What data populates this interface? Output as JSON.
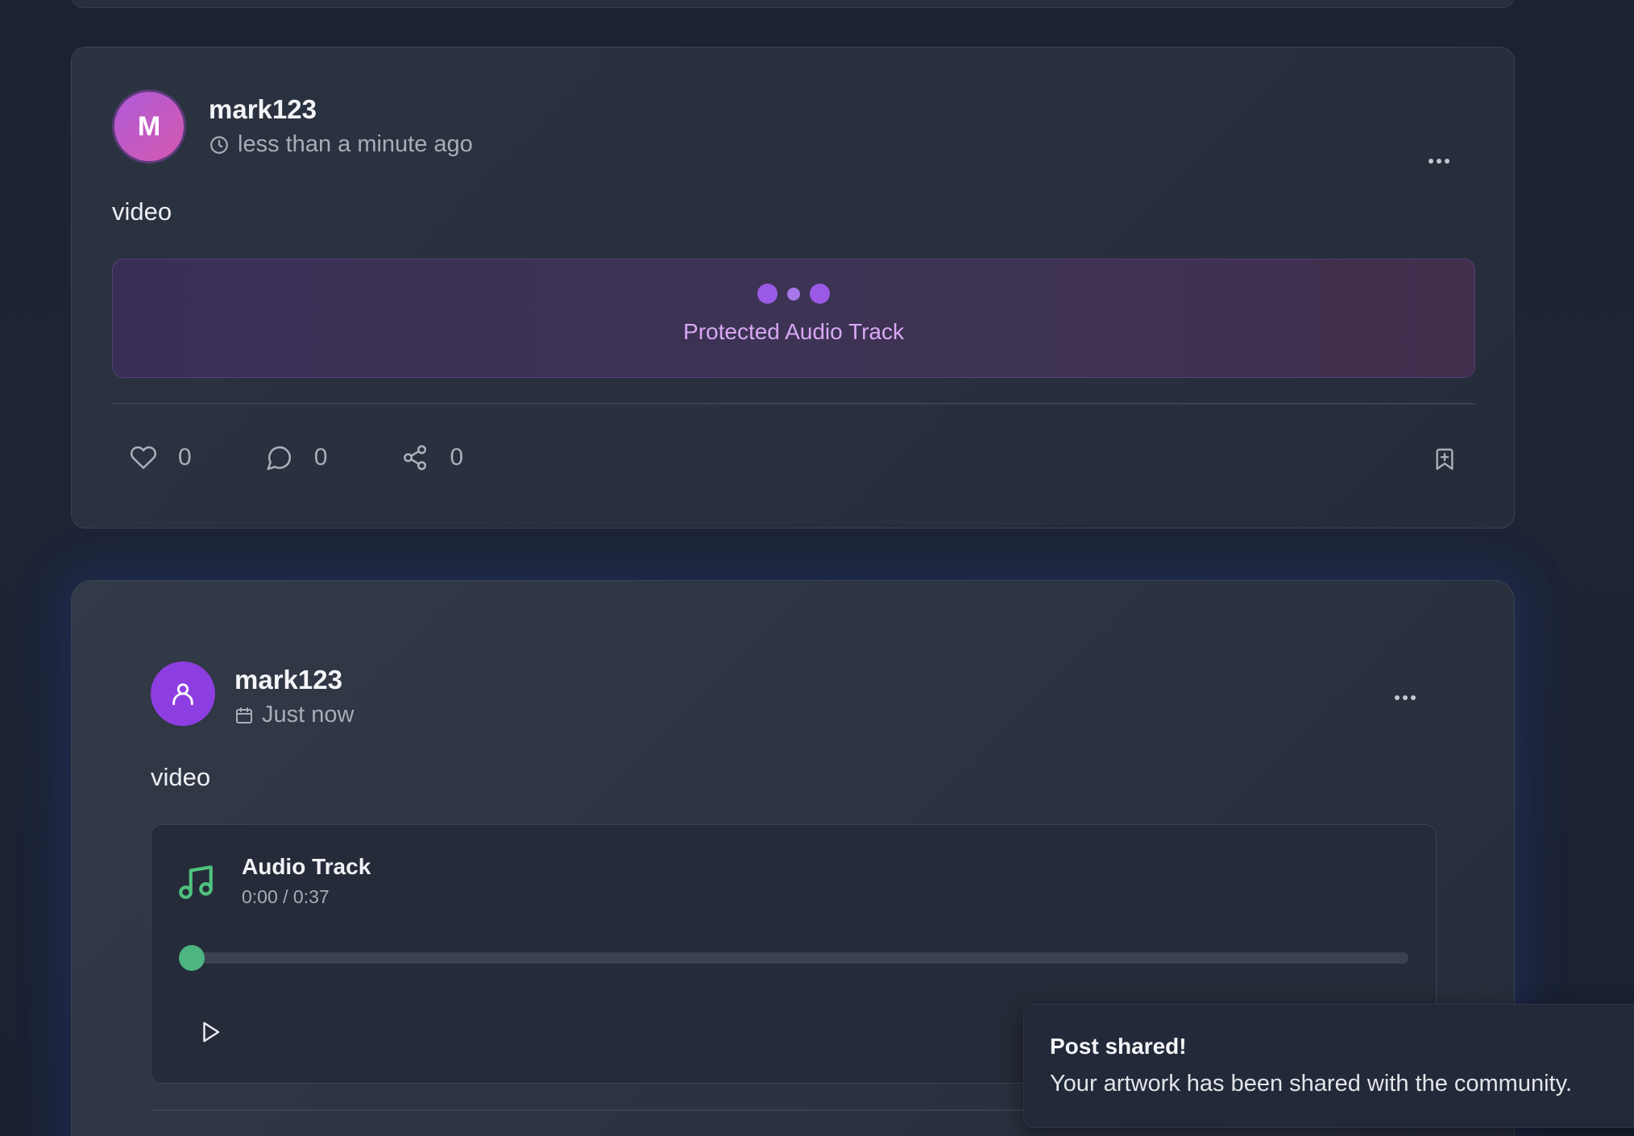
{
  "posts": [
    {
      "username": "mark123",
      "avatar_initial": "M",
      "timestamp": "less than a minute ago",
      "text": "video",
      "protected_label": "Protected Audio Track",
      "likes": "0",
      "comments": "0",
      "shares": "0"
    },
    {
      "username": "mark123",
      "timestamp": "Just now",
      "text": "video",
      "audio": {
        "title": "Audio Track",
        "time": "0:00 / 0:37",
        "progress": 0
      }
    }
  ],
  "toast": {
    "title": "Post shared!",
    "description": "Your artwork has been shared with the community."
  },
  "colors": {
    "accent_purple": "#8d3ee0",
    "accent_green": "#4cb582",
    "protected_text": "#d9a8f4"
  },
  "icons": {
    "time_icon_1": "clock-icon",
    "time_icon_2": "calendar-icon",
    "more": "more-horizontal-icon",
    "like": "heart-icon",
    "comment": "comment-icon",
    "share": "share-icon",
    "bookmark": "bookmark-icon",
    "music": "music-note-icon",
    "play": "play-icon",
    "avatar": "user-icon"
  }
}
